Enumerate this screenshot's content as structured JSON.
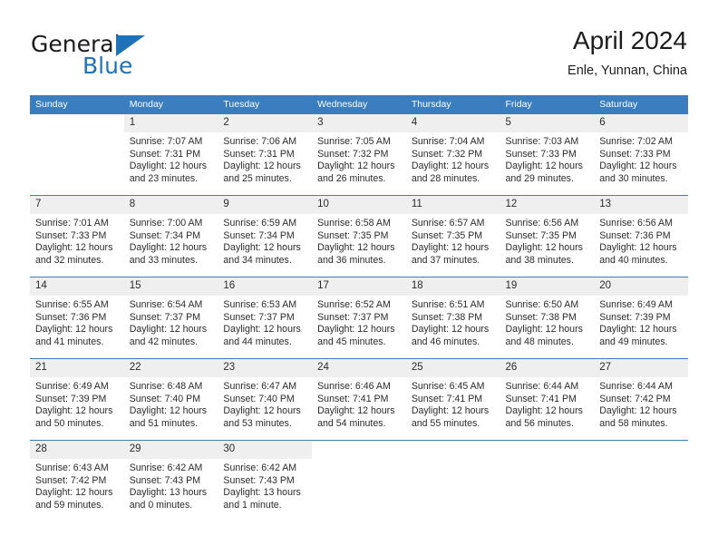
{
  "brand": {
    "name_top": "General",
    "name_bottom": "Blue",
    "accent_color": "#1f72b8",
    "triangle_icon": "brand-triangle-icon"
  },
  "header": {
    "title": "April 2024",
    "subtitle": "Enle, Yunnan, China"
  },
  "calendar": {
    "header_bg": "#3a7ebf",
    "daynum_bg": "#efefef",
    "weekdays": [
      "Sunday",
      "Monday",
      "Tuesday",
      "Wednesday",
      "Thursday",
      "Friday",
      "Saturday"
    ],
    "weeks": [
      [
        {
          "day": "",
          "empty": true
        },
        {
          "day": "1",
          "sunrise": "Sunrise: 7:07 AM",
          "sunset": "Sunset: 7:31 PM",
          "daylight1": "Daylight: 12 hours",
          "daylight2": "and 23 minutes."
        },
        {
          "day": "2",
          "sunrise": "Sunrise: 7:06 AM",
          "sunset": "Sunset: 7:31 PM",
          "daylight1": "Daylight: 12 hours",
          "daylight2": "and 25 minutes."
        },
        {
          "day": "3",
          "sunrise": "Sunrise: 7:05 AM",
          "sunset": "Sunset: 7:32 PM",
          "daylight1": "Daylight: 12 hours",
          "daylight2": "and 26 minutes."
        },
        {
          "day": "4",
          "sunrise": "Sunrise: 7:04 AM",
          "sunset": "Sunset: 7:32 PM",
          "daylight1": "Daylight: 12 hours",
          "daylight2": "and 28 minutes."
        },
        {
          "day": "5",
          "sunrise": "Sunrise: 7:03 AM",
          "sunset": "Sunset: 7:33 PM",
          "daylight1": "Daylight: 12 hours",
          "daylight2": "and 29 minutes."
        },
        {
          "day": "6",
          "sunrise": "Sunrise: 7:02 AM",
          "sunset": "Sunset: 7:33 PM",
          "daylight1": "Daylight: 12 hours",
          "daylight2": "and 30 minutes."
        }
      ],
      [
        {
          "day": "7",
          "sunrise": "Sunrise: 7:01 AM",
          "sunset": "Sunset: 7:33 PM",
          "daylight1": "Daylight: 12 hours",
          "daylight2": "and 32 minutes."
        },
        {
          "day": "8",
          "sunrise": "Sunrise: 7:00 AM",
          "sunset": "Sunset: 7:34 PM",
          "daylight1": "Daylight: 12 hours",
          "daylight2": "and 33 minutes."
        },
        {
          "day": "9",
          "sunrise": "Sunrise: 6:59 AM",
          "sunset": "Sunset: 7:34 PM",
          "daylight1": "Daylight: 12 hours",
          "daylight2": "and 34 minutes."
        },
        {
          "day": "10",
          "sunrise": "Sunrise: 6:58 AM",
          "sunset": "Sunset: 7:35 PM",
          "daylight1": "Daylight: 12 hours",
          "daylight2": "and 36 minutes."
        },
        {
          "day": "11",
          "sunrise": "Sunrise: 6:57 AM",
          "sunset": "Sunset: 7:35 PM",
          "daylight1": "Daylight: 12 hours",
          "daylight2": "and 37 minutes."
        },
        {
          "day": "12",
          "sunrise": "Sunrise: 6:56 AM",
          "sunset": "Sunset: 7:35 PM",
          "daylight1": "Daylight: 12 hours",
          "daylight2": "and 38 minutes."
        },
        {
          "day": "13",
          "sunrise": "Sunrise: 6:56 AM",
          "sunset": "Sunset: 7:36 PM",
          "daylight1": "Daylight: 12 hours",
          "daylight2": "and 40 minutes."
        }
      ],
      [
        {
          "day": "14",
          "sunrise": "Sunrise: 6:55 AM",
          "sunset": "Sunset: 7:36 PM",
          "daylight1": "Daylight: 12 hours",
          "daylight2": "and 41 minutes."
        },
        {
          "day": "15",
          "sunrise": "Sunrise: 6:54 AM",
          "sunset": "Sunset: 7:37 PM",
          "daylight1": "Daylight: 12 hours",
          "daylight2": "and 42 minutes."
        },
        {
          "day": "16",
          "sunrise": "Sunrise: 6:53 AM",
          "sunset": "Sunset: 7:37 PM",
          "daylight1": "Daylight: 12 hours",
          "daylight2": "and 44 minutes."
        },
        {
          "day": "17",
          "sunrise": "Sunrise: 6:52 AM",
          "sunset": "Sunset: 7:37 PM",
          "daylight1": "Daylight: 12 hours",
          "daylight2": "and 45 minutes."
        },
        {
          "day": "18",
          "sunrise": "Sunrise: 6:51 AM",
          "sunset": "Sunset: 7:38 PM",
          "daylight1": "Daylight: 12 hours",
          "daylight2": "and 46 minutes."
        },
        {
          "day": "19",
          "sunrise": "Sunrise: 6:50 AM",
          "sunset": "Sunset: 7:38 PM",
          "daylight1": "Daylight: 12 hours",
          "daylight2": "and 48 minutes."
        },
        {
          "day": "20",
          "sunrise": "Sunrise: 6:49 AM",
          "sunset": "Sunset: 7:39 PM",
          "daylight1": "Daylight: 12 hours",
          "daylight2": "and 49 minutes."
        }
      ],
      [
        {
          "day": "21",
          "sunrise": "Sunrise: 6:49 AM",
          "sunset": "Sunset: 7:39 PM",
          "daylight1": "Daylight: 12 hours",
          "daylight2": "and 50 minutes."
        },
        {
          "day": "22",
          "sunrise": "Sunrise: 6:48 AM",
          "sunset": "Sunset: 7:40 PM",
          "daylight1": "Daylight: 12 hours",
          "daylight2": "and 51 minutes."
        },
        {
          "day": "23",
          "sunrise": "Sunrise: 6:47 AM",
          "sunset": "Sunset: 7:40 PM",
          "daylight1": "Daylight: 12 hours",
          "daylight2": "and 53 minutes."
        },
        {
          "day": "24",
          "sunrise": "Sunrise: 6:46 AM",
          "sunset": "Sunset: 7:41 PM",
          "daylight1": "Daylight: 12 hours",
          "daylight2": "and 54 minutes."
        },
        {
          "day": "25",
          "sunrise": "Sunrise: 6:45 AM",
          "sunset": "Sunset: 7:41 PM",
          "daylight1": "Daylight: 12 hours",
          "daylight2": "and 55 minutes."
        },
        {
          "day": "26",
          "sunrise": "Sunrise: 6:44 AM",
          "sunset": "Sunset: 7:41 PM",
          "daylight1": "Daylight: 12 hours",
          "daylight2": "and 56 minutes."
        },
        {
          "day": "27",
          "sunrise": "Sunrise: 6:44 AM",
          "sunset": "Sunset: 7:42 PM",
          "daylight1": "Daylight: 12 hours",
          "daylight2": "and 58 minutes."
        }
      ],
      [
        {
          "day": "28",
          "sunrise": "Sunrise: 6:43 AM",
          "sunset": "Sunset: 7:42 PM",
          "daylight1": "Daylight: 12 hours",
          "daylight2": "and 59 minutes."
        },
        {
          "day": "29",
          "sunrise": "Sunrise: 6:42 AM",
          "sunset": "Sunset: 7:43 PM",
          "daylight1": "Daylight: 13 hours",
          "daylight2": "and 0 minutes."
        },
        {
          "day": "30",
          "sunrise": "Sunrise: 6:42 AM",
          "sunset": "Sunset: 7:43 PM",
          "daylight1": "Daylight: 13 hours",
          "daylight2": "and 1 minute."
        },
        {
          "day": "",
          "empty": true
        },
        {
          "day": "",
          "empty": true
        },
        {
          "day": "",
          "empty": true
        },
        {
          "day": "",
          "empty": true
        }
      ]
    ]
  }
}
